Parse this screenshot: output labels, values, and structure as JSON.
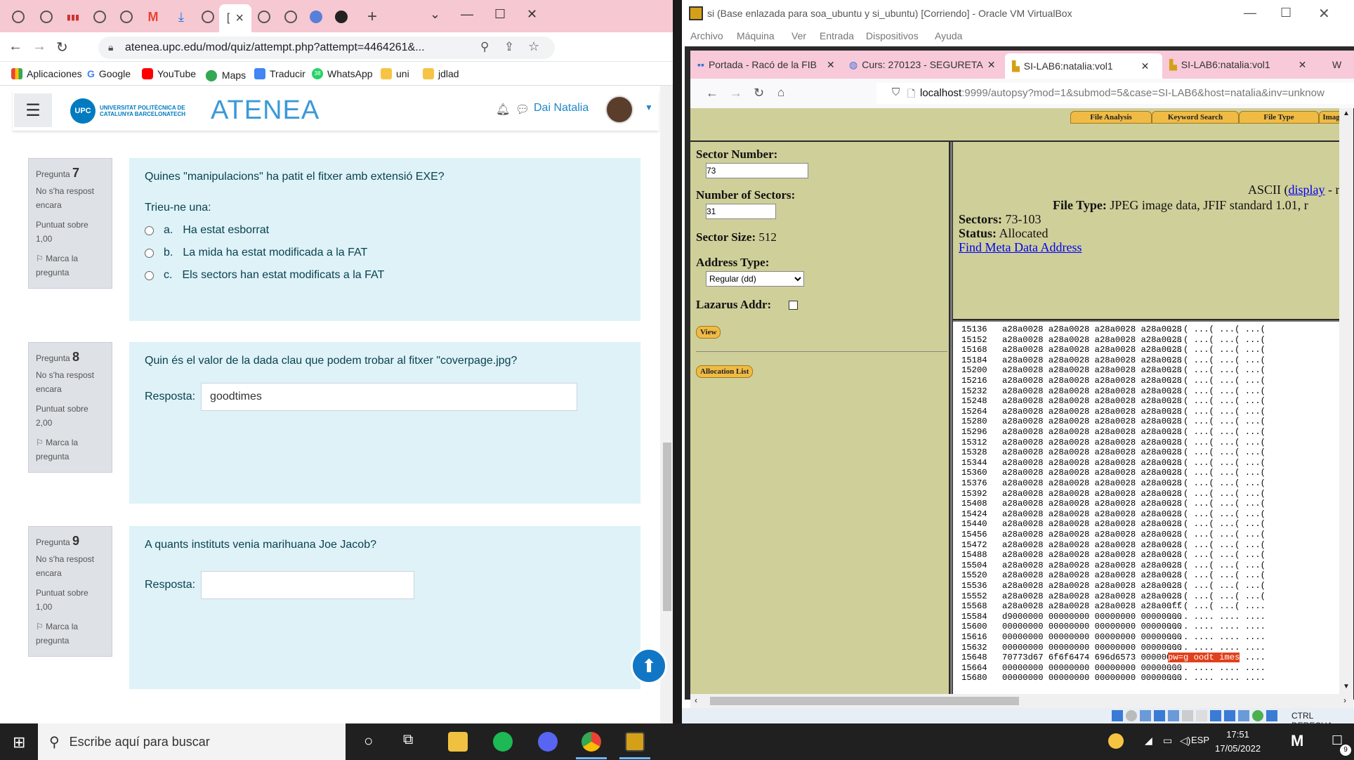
{
  "left_browser": {
    "tabs": [
      {
        "icon": "globe-icon"
      },
      {
        "icon": "globe-icon"
      },
      {
        "icon": "upc-icon"
      },
      {
        "icon": "globe-icon"
      },
      {
        "icon": "globe-icon"
      },
      {
        "icon": "gmail-icon"
      },
      {
        "icon": "download-icon"
      },
      {
        "icon": "globe-icon"
      },
      {
        "icon": "active-tab",
        "label": "[",
        "close": "×"
      },
      {
        "icon": "globe-icon"
      },
      {
        "icon": "globe-icon"
      },
      {
        "icon": "web-icon"
      },
      {
        "icon": "github-icon"
      }
    ],
    "new_tab": "+",
    "url": "atenea.upc.edu/mod/quiz/attempt.php?attempt=4464261&...",
    "bookmarks": [
      {
        "label": "Aplicaciones",
        "icon": "apps-icon",
        "color": "#4285f4"
      },
      {
        "label": "Google",
        "icon": "google-icon",
        "color": "#ea4335"
      },
      {
        "label": "YouTube",
        "icon": "youtube-icon",
        "color": "#ff0000"
      },
      {
        "label": "Maps",
        "icon": "maps-icon",
        "color": "#34a853"
      },
      {
        "label": "Traducir",
        "icon": "translate-icon",
        "color": "#4285f4"
      },
      {
        "label": "WhatsApp",
        "icon": "whatsapp-icon",
        "color": "#25d366",
        "badge": "38"
      },
      {
        "label": "uni",
        "icon": "folder-icon",
        "color": "#f6c445"
      },
      {
        "label": "jdlad",
        "icon": "folder-icon",
        "color": "#f6c445"
      }
    ]
  },
  "moodle": {
    "university": "UNIVERSITAT POLITÈCNICA DE CATALUNYA BARCELONATECH",
    "university_short": "UPC",
    "site": "ATENEA",
    "user": "Dai Natalia",
    "questions": [
      {
        "prefix": "Pregunta",
        "number": "7",
        "status": "No s'ha respost encara",
        "score": "Puntuat sobre 1,00",
        "flag": "Marca la pregunta",
        "text": "Quines \"manipulacions\" ha patit el fitxer amb extensió EXE?",
        "prompt": "Trieu-ne una:",
        "options": [
          {
            "letter": "a.",
            "text": "Ha estat esborrat"
          },
          {
            "letter": "b.",
            "text": "La mida ha estat modificada a la FAT"
          },
          {
            "letter": "c.",
            "text": "Els sectors han estat modificats a la FAT"
          }
        ]
      },
      {
        "prefix": "Pregunta",
        "number": "8",
        "status": "No s'ha respost encara",
        "score": "Puntuat sobre 2,00",
        "flag": "Marca la pregunta",
        "text": "Quin és el valor de la dada clau que podem trobar al fitxer \"coverpage.jpg?",
        "answer_label": "Resposta:",
        "answer": "goodtimes"
      },
      {
        "prefix": "Pregunta",
        "number": "9",
        "status": "No s'ha respost encara",
        "score": "Puntuat sobre 1,00",
        "flag": "Marca la pregunta",
        "text": "A quants instituts venia marihuana Joe Jacob?",
        "answer_label": "Resposta:",
        "answer": ""
      }
    ]
  },
  "virtualbox": {
    "title": "si (Base enlazada para soa_ubuntu y si_ubuntu) [Corriendo] - Oracle VM VirtualBox",
    "menu": [
      "Archivo",
      "Máquina",
      "Ver",
      "Entrada",
      "Dispositivos",
      "Ayuda"
    ],
    "status_text": "CTRL DERECHA"
  },
  "firefox": {
    "tabs": [
      {
        "label": "Portada - Racó de la FIB",
        "icon": "fib-icon"
      },
      {
        "label": "Curs: 270123 - SEGURETA",
        "icon": "globe-icon"
      },
      {
        "label": "SI-LAB6:natalia:vol1",
        "icon": "autopsy-icon",
        "active": true
      },
      {
        "label": "SI-LAB6:natalia:vol1",
        "icon": "autopsy-icon"
      },
      {
        "label": "W",
        "icon": "wiki-icon"
      }
    ],
    "url_host": "localhost",
    "url_rest": ":9999/autopsy?mod=1&submod=5&case=SI-LAB6&host=natalia&inv=unknow"
  },
  "autopsy": {
    "top_tabs": [
      "File Analysis",
      "Keyword Search",
      "File Type",
      "Image"
    ],
    "sector_number_label": "Sector Number:",
    "sector_number": "73",
    "num_sectors_label": "Number of Sectors:",
    "num_sectors": "31",
    "sector_size_label": "Sector Size:",
    "sector_size": "512",
    "address_type_label": "Address Type:",
    "address_type": "Regular (dd)",
    "lazarus_label": "Lazarus Addr:",
    "view_button": "View",
    "allocation_button": "Allocation List",
    "ascii_label": "ASCII (",
    "display_link": "display",
    "display_more": " - r",
    "file_type_label": "File Type:",
    "file_type": "JPEG image data, JFIF standard 1.01, r",
    "sectors_label": "Sectors:",
    "sectors": "73-103",
    "status_label": "Status:",
    "status": "Allocated",
    "meta_link": "Find Meta Data Address",
    "hex_rows": [
      {
        "off": "15136",
        "hex": "a28a0028 a28a0028 a28a0028 a28a0028",
        "asc": "...( ...( ...( ...("
      },
      {
        "off": "15152",
        "hex": "a28a0028 a28a0028 a28a0028 a28a0028",
        "asc": "...( ...( ...( ...("
      },
      {
        "off": "15168",
        "hex": "a28a0028 a28a0028 a28a0028 a28a0028",
        "asc": "...( ...( ...( ...("
      },
      {
        "off": "15184",
        "hex": "a28a0028 a28a0028 a28a0028 a28a0028",
        "asc": "...( ...( ...( ...("
      },
      {
        "off": "15200",
        "hex": "a28a0028 a28a0028 a28a0028 a28a0028",
        "asc": "...( ...( ...( ...("
      },
      {
        "off": "15216",
        "hex": "a28a0028 a28a0028 a28a0028 a28a0028",
        "asc": "...( ...( ...( ...("
      },
      {
        "off": "15232",
        "hex": "a28a0028 a28a0028 a28a0028 a28a0028",
        "asc": "...( ...( ...( ...("
      },
      {
        "off": "15248",
        "hex": "a28a0028 a28a0028 a28a0028 a28a0028",
        "asc": "...( ...( ...( ...("
      },
      {
        "off": "15264",
        "hex": "a28a0028 a28a0028 a28a0028 a28a0028",
        "asc": "...( ...( ...( ...("
      },
      {
        "off": "15280",
        "hex": "a28a0028 a28a0028 a28a0028 a28a0028",
        "asc": "...( ...( ...( ...("
      },
      {
        "off": "15296",
        "hex": "a28a0028 a28a0028 a28a0028 a28a0028",
        "asc": "...( ...( ...( ...("
      },
      {
        "off": "15312",
        "hex": "a28a0028 a28a0028 a28a0028 a28a0028",
        "asc": "...( ...( ...( ...("
      },
      {
        "off": "15328",
        "hex": "a28a0028 a28a0028 a28a0028 a28a0028",
        "asc": "...( ...( ...( ...("
      },
      {
        "off": "15344",
        "hex": "a28a0028 a28a0028 a28a0028 a28a0028",
        "asc": "...( ...( ...( ...("
      },
      {
        "off": "15360",
        "hex": "a28a0028 a28a0028 a28a0028 a28a0028",
        "asc": "...( ...( ...( ...("
      },
      {
        "off": "15376",
        "hex": "a28a0028 a28a0028 a28a0028 a28a0028",
        "asc": "...( ...( ...( ...("
      },
      {
        "off": "15392",
        "hex": "a28a0028 a28a0028 a28a0028 a28a0028",
        "asc": "...( ...( ...( ...("
      },
      {
        "off": "15408",
        "hex": "a28a0028 a28a0028 a28a0028 a28a0028",
        "asc": "...( ...( ...( ...("
      },
      {
        "off": "15424",
        "hex": "a28a0028 a28a0028 a28a0028 a28a0028",
        "asc": "...( ...( ...( ...("
      },
      {
        "off": "15440",
        "hex": "a28a0028 a28a0028 a28a0028 a28a0028",
        "asc": "...( ...( ...( ...("
      },
      {
        "off": "15456",
        "hex": "a28a0028 a28a0028 a28a0028 a28a0028",
        "asc": "...( ...( ...( ...("
      },
      {
        "off": "15472",
        "hex": "a28a0028 a28a0028 a28a0028 a28a0028",
        "asc": "...( ...( ...( ...("
      },
      {
        "off": "15488",
        "hex": "a28a0028 a28a0028 a28a0028 a28a0028",
        "asc": "...( ...( ...( ...("
      },
      {
        "off": "15504",
        "hex": "a28a0028 a28a0028 a28a0028 a28a0028",
        "asc": "...( ...( ...( ...("
      },
      {
        "off": "15520",
        "hex": "a28a0028 a28a0028 a28a0028 a28a0028",
        "asc": "...( ...( ...( ...("
      },
      {
        "off": "15536",
        "hex": "a28a0028 a28a0028 a28a0028 a28a0028",
        "asc": "...( ...( ...( ...("
      },
      {
        "off": "15552",
        "hex": "a28a0028 a28a0028 a28a0028 a28a0028",
        "asc": "...( ...( ...( ...("
      },
      {
        "off": "15568",
        "hex": "a28a0028 a28a0028 a28a0028 a28a00ff",
        "asc": "...( ...( ...( ...."
      },
      {
        "off": "15584",
        "hex": "d9000000 00000000 00000000 00000000",
        "asc": ".... .... .... ...."
      },
      {
        "off": "15600",
        "hex": "00000000 00000000 00000000 00000000",
        "asc": ".... .... .... ...."
      },
      {
        "off": "15616",
        "hex": "00000000 00000000 00000000 00000000",
        "asc": ".... .... .... ...."
      },
      {
        "off": "15632",
        "hex": "00000000 00000000 00000000 00000000",
        "asc": ".... .... .... ...."
      },
      {
        "off": "15648",
        "hex": "70773d67 6f6f6474 696d6573 00000000",
        "asc_hl": "pw=g oodt imes",
        "asc": " ...."
      },
      {
        "off": "15664",
        "hex": "00000000 00000000 00000000 00000000",
        "asc": ".... .... .... ...."
      },
      {
        "off": "15680",
        "hex": "00000000 00000000 00000000 00000000",
        "asc": ".... .... .... ...."
      }
    ]
  },
  "taskbar": {
    "search_placeholder": "Escribe aquí para buscar",
    "lang": "ESP",
    "time": "17:51",
    "date": "17/05/2022",
    "notifications": "9"
  }
}
